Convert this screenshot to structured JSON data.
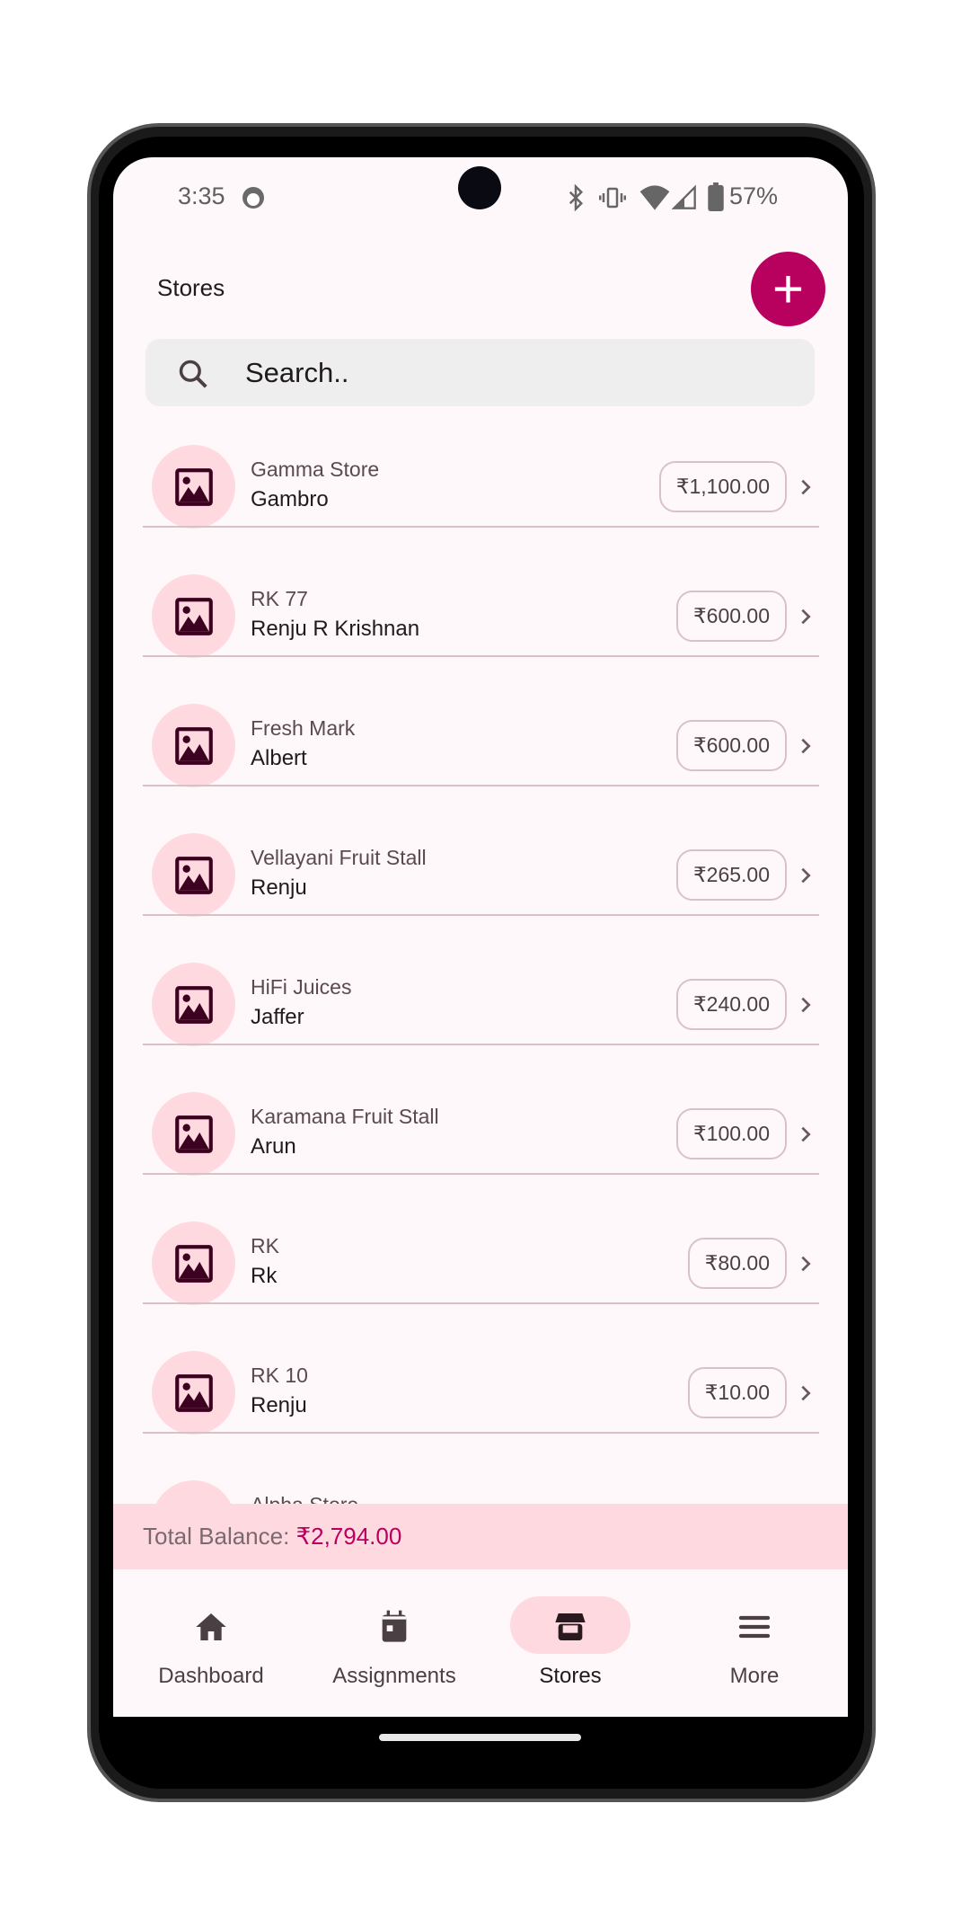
{
  "status_bar": {
    "time": "3:35",
    "battery": "57%",
    "icons": [
      "bluetooth-icon",
      "vibrate-icon",
      "wifi-icon",
      "signal-icon",
      "battery-icon"
    ]
  },
  "header": {
    "title": "Stores",
    "add_icon": "plus-icon"
  },
  "search": {
    "placeholder": "Search.."
  },
  "stores": [
    {
      "name": "Gamma Store",
      "owner": "Gambro",
      "balance": "₹1,100.00"
    },
    {
      "name": "RK 77",
      "owner": "Renju R Krishnan",
      "balance": "₹600.00"
    },
    {
      "name": "Fresh Mark",
      "owner": "Albert",
      "balance": "₹600.00"
    },
    {
      "name": "Vellayani Fruit Stall",
      "owner": "Renju",
      "balance": "₹265.00"
    },
    {
      "name": "HiFi Juices",
      "owner": "Jaffer",
      "balance": "₹240.00"
    },
    {
      "name": "Karamana Fruit Stall",
      "owner": "Arun",
      "balance": "₹100.00"
    },
    {
      "name": "RK",
      "owner": "Rk",
      "balance": "₹80.00"
    },
    {
      "name": "RK 10",
      "owner": "Renju",
      "balance": "₹10.00"
    },
    {
      "name": "Alpha Store",
      "owner": "",
      "balance": ""
    }
  ],
  "total": {
    "label": "Total Balance: ",
    "value": "₹2,794.00"
  },
  "nav": [
    {
      "label": "Dashboard",
      "icon": "home-icon"
    },
    {
      "label": "Assignments",
      "icon": "calendar-icon"
    },
    {
      "label": "Stores",
      "icon": "store-icon",
      "active": true
    },
    {
      "label": "More",
      "icon": "menu-icon"
    }
  ],
  "colors": {
    "accent": "#b8005f",
    "avatar_bg": "#ffd9e0",
    "icon": "#3d0021",
    "background": "#fff8fb"
  }
}
